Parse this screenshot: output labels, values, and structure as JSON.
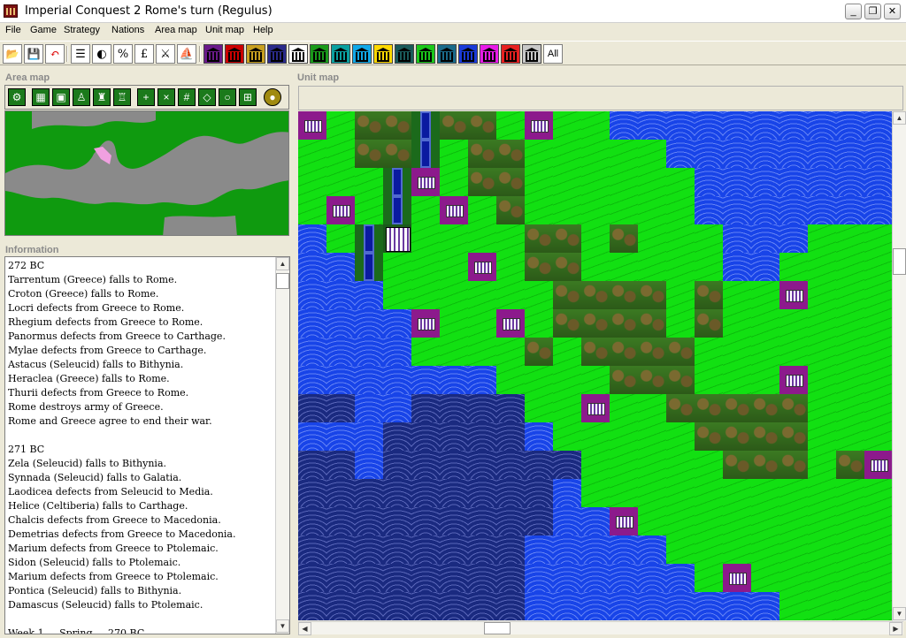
{
  "window": {
    "title": "Imperial Conquest 2   Rome's turn   (Regulus)",
    "minimize_label": "_",
    "maximize_label": "❐",
    "close_label": "✕"
  },
  "menu": [
    "File",
    "Game",
    "Strategy",
    "Nations",
    "Area map",
    "Unit map",
    "Help"
  ],
  "toolbar": {
    "tools": [
      {
        "name": "open-icon",
        "glyph": "📂"
      },
      {
        "name": "save-icon",
        "glyph": "💾"
      },
      {
        "name": "undo-icon",
        "glyph": "↶"
      },
      {
        "name": "list-icon",
        "glyph": "☰"
      },
      {
        "name": "contrast-icon",
        "glyph": "◐"
      },
      {
        "name": "percent-icon",
        "glyph": "%"
      },
      {
        "name": "pound-icon",
        "glyph": "£"
      },
      {
        "name": "crossed-swords-icon",
        "glyph": "⚔"
      },
      {
        "name": "ship-icon",
        "glyph": "⛵"
      }
    ],
    "nation_colors": [
      "#6a1a8a",
      "#cc0000",
      "#c8a020",
      "#2a2a8a",
      "#ffffff",
      "#1a9a1a",
      "#0aa0a0",
      "#10a8e8",
      "#ffd800",
      "#1a5a5a",
      "#1ac81a",
      "#1a6a8a",
      "#1a3ad8",
      "#e81ae8",
      "#e82020",
      "#c8c8c8"
    ],
    "all_label": "All"
  },
  "area_map": {
    "title": "Area map",
    "tools": [
      "⚙",
      "▦",
      "▣",
      "♙",
      "♜",
      "♖",
      "+",
      "×",
      "#",
      "◇",
      "○",
      "⊞",
      "●"
    ]
  },
  "information": {
    "title": "Information",
    "lines": [
      "272 BC",
      "Tarrentum (Greece) falls to Rome.",
      "Croton (Greece) falls to Rome.",
      "Locri defects from Greece to Rome.",
      "Rhegium defects from Greece to Rome.",
      "Panormus defects from Greece to Carthage.",
      "Mylae defects from Greece to Carthage.",
      "Astacus (Seleucid) falls to Bithynia.",
      "Heraclea (Greece) falls to Rome.",
      "Thurii defects from Greece to Rome.",
      "Rome destroys army of Greece.",
      "Rome and Greece agree to end their war.",
      "",
      "271 BC",
      "Zela (Seleucid) falls to Bithynia.",
      "Synnada (Seleucid) falls to Galatia.",
      "Laodicea defects from Seleucid to Media.",
      "Helice (Celtiberia) falls to Carthage.",
      "Chalcis defects from Greece to Macedonia.",
      "Demetrias defects from Greece to Macedonia.",
      "Marium defects from Greece to Ptolemaic.",
      "Sidon (Seleucid) falls to Ptolemaic.",
      "Marium defects from Greece to Ptolemaic.",
      "Pontica (Seleucid) falls to Bithynia.",
      "Damascus (Seleucid) falls to Ptolemaic.",
      "",
      "Week 1 ... Spring ... 270 BC"
    ]
  },
  "unit_map": {
    "title": "Unit map"
  },
  "colors": {
    "grass": "#12e012",
    "water": "#1844e8",
    "deep_water": "#1a2a80",
    "forest": "#2e6f1e",
    "city": "#8c1a8c",
    "land_grey": "#8a8a8a",
    "rome_highlight": "#f0a0e0"
  }
}
